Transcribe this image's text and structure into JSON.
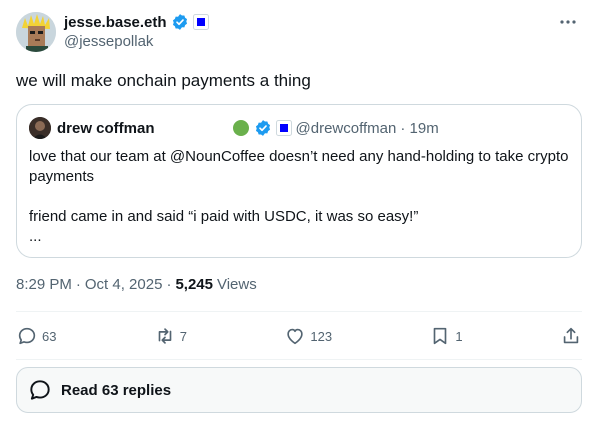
{
  "author": {
    "display_name": "jesse.base.eth",
    "handle": "@jessepollak",
    "avatar_icon": "avatar-icon",
    "verified_color": "#1d9bf0",
    "affiliate_badge_color": "#0000ff"
  },
  "post": {
    "text": "we will make onchain payments a thing"
  },
  "quote": {
    "display_name": "drew coffman",
    "handle": "@drewcoffman",
    "time": "· 19m",
    "text_line1": "love that our team at @NounCoffee doesn’t need any hand-holding to take crypto payments",
    "text_line2": "friend came in and said “i paid with USDC, it was so easy!”",
    "text_line3": "...",
    "status_dot_color": "#6ab04c"
  },
  "meta": {
    "time": "8:29 PM",
    "separator": "·",
    "date": "Oct 4, 2025",
    "separator2": "·",
    "views_count": "5,245",
    "views_label": "Views"
  },
  "actions": {
    "reply_count": "63",
    "repost_count": "7",
    "like_count": "123",
    "bookmark_count": "1"
  },
  "replies": {
    "label": "Read 63 replies"
  }
}
